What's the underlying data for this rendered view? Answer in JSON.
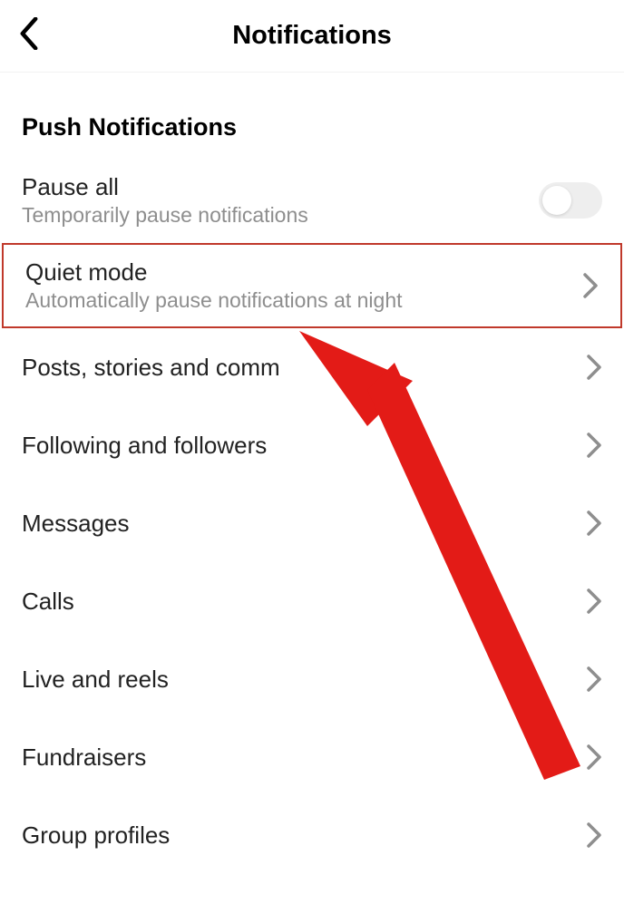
{
  "header": {
    "title": "Notifications"
  },
  "section": {
    "title": "Push Notifications"
  },
  "rows": {
    "pause_all": {
      "label": "Pause all",
      "sub": "Temporarily pause notifications"
    },
    "quiet_mode": {
      "label": "Quiet mode",
      "sub": "Automatically pause notifications at night"
    },
    "posts": {
      "label": "Posts, stories and comm"
    },
    "following": {
      "label": "Following and followers"
    },
    "messages": {
      "label": "Messages"
    },
    "calls": {
      "label": "Calls"
    },
    "live": {
      "label": "Live and reels"
    },
    "fundraisers": {
      "label": "Fundraisers"
    },
    "group_profiles": {
      "label": "Group profiles"
    }
  },
  "colors": {
    "highlight": "#c0392b",
    "arrow": "#e31b17"
  }
}
